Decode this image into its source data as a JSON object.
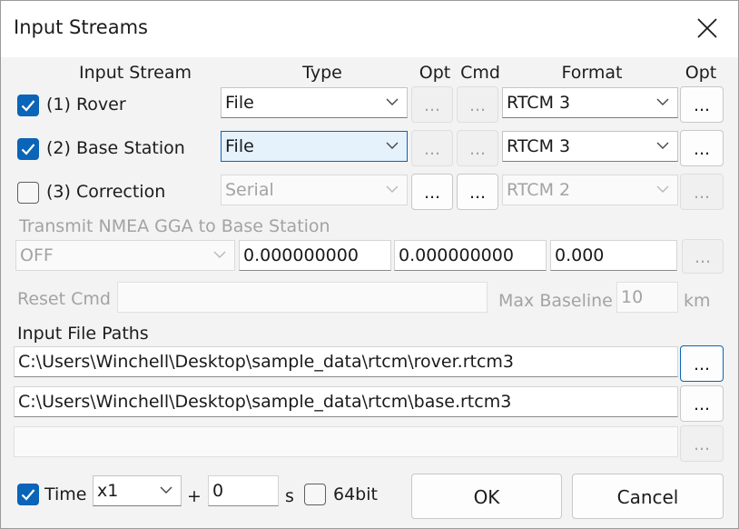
{
  "window": {
    "title": "Input Streams"
  },
  "headers": {
    "input_stream": "Input Stream",
    "type": "Type",
    "opt1": "Opt",
    "cmd": "Cmd",
    "format": "Format",
    "opt2": "Opt"
  },
  "streams": [
    {
      "label": "(1) Rover",
      "checked": true,
      "type": "File",
      "format": "RTCM 3",
      "cmd_btn": "...",
      "opt_btn": "...",
      "fmt_opt_btn": "..."
    },
    {
      "label": "(2) Base Station",
      "checked": true,
      "type": "File",
      "format": "RTCM 3",
      "cmd_btn": "...",
      "opt_btn": "...",
      "fmt_opt_btn": "..."
    },
    {
      "label": "(3) Correction",
      "checked": false,
      "type": "Serial",
      "format": "RTCM 2",
      "cmd_btn": "...",
      "opt_btn": "...",
      "fmt_opt_btn": "..."
    }
  ],
  "nmea": {
    "label": "Transmit NMEA GGA to Base Station",
    "mode": "OFF",
    "lat": "0.000000000",
    "lon": "0.000000000",
    "height": "0.000",
    "btn": "..."
  },
  "reset": {
    "label": "Reset Cmd",
    "value": ""
  },
  "baseline": {
    "label": "Max Baseline",
    "value": "10",
    "unit": "km"
  },
  "paths": {
    "label": "Input File Paths",
    "items": [
      {
        "value": "C:\\Users\\Winchell\\Desktop\\sample_data\\rtcm\\rover.rtcm3",
        "btn": "..."
      },
      {
        "value": "C:\\Users\\Winchell\\Desktop\\sample_data\\rtcm\\base.rtcm3",
        "btn": "..."
      },
      {
        "value": "",
        "btn": "..."
      }
    ]
  },
  "time": {
    "label": "Time",
    "checked": true,
    "speed": "x1",
    "plus": "+",
    "offset": "0",
    "unit": "s",
    "bit64_label": "64bit",
    "bit64_checked": false
  },
  "buttons": {
    "ok": "OK",
    "cancel": "Cancel"
  },
  "colors": {
    "accent": "#0a64b8",
    "disabled_text": "#a3a3a3",
    "dialog_bg": "#f3f3f3"
  }
}
